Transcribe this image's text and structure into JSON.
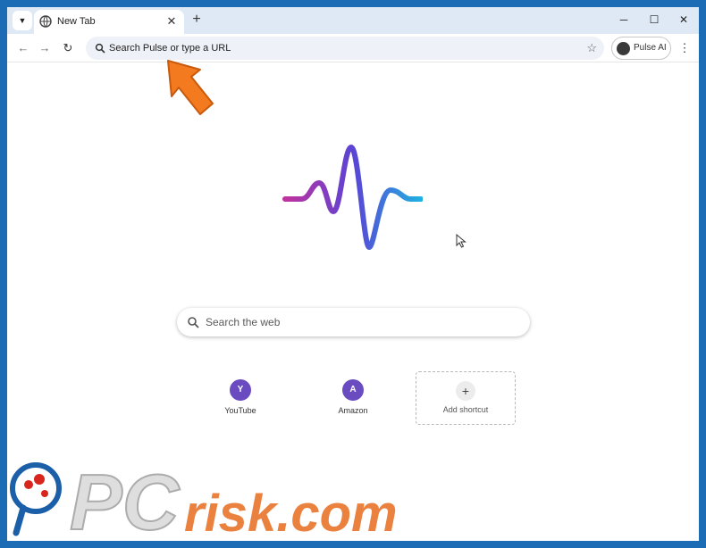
{
  "browser": {
    "tab": {
      "title": "New Tab"
    },
    "new_tab_symbol": "+",
    "window_controls": {
      "minimize": "─",
      "maximize": "☐",
      "close": "✕"
    }
  },
  "toolbar": {
    "address_placeholder": "Search Pulse or type a URL",
    "extension_label": "Pulse AI",
    "menu_symbol": "⋮"
  },
  "page": {
    "search_placeholder": "Search the web",
    "shortcuts": [
      {
        "label": "YouTube",
        "initial": "Y",
        "color": "#6a4cc0"
      },
      {
        "label": "Amazon",
        "initial": "A",
        "color": "#6a4cc0"
      }
    ],
    "add_shortcut_label": "Add shortcut",
    "add_shortcut_symbol": "+"
  },
  "logo_colors": {
    "gradient_start": "#c0339e",
    "gradient_mid": "#5a44d6",
    "gradient_end": "#1fb1e0"
  },
  "watermark": {
    "brand": "PCrisk.com",
    "brand_prefix": "PC",
    "brand_suffix": "risk.com"
  },
  "overlay": {
    "arrow_color": "#f47a20"
  }
}
